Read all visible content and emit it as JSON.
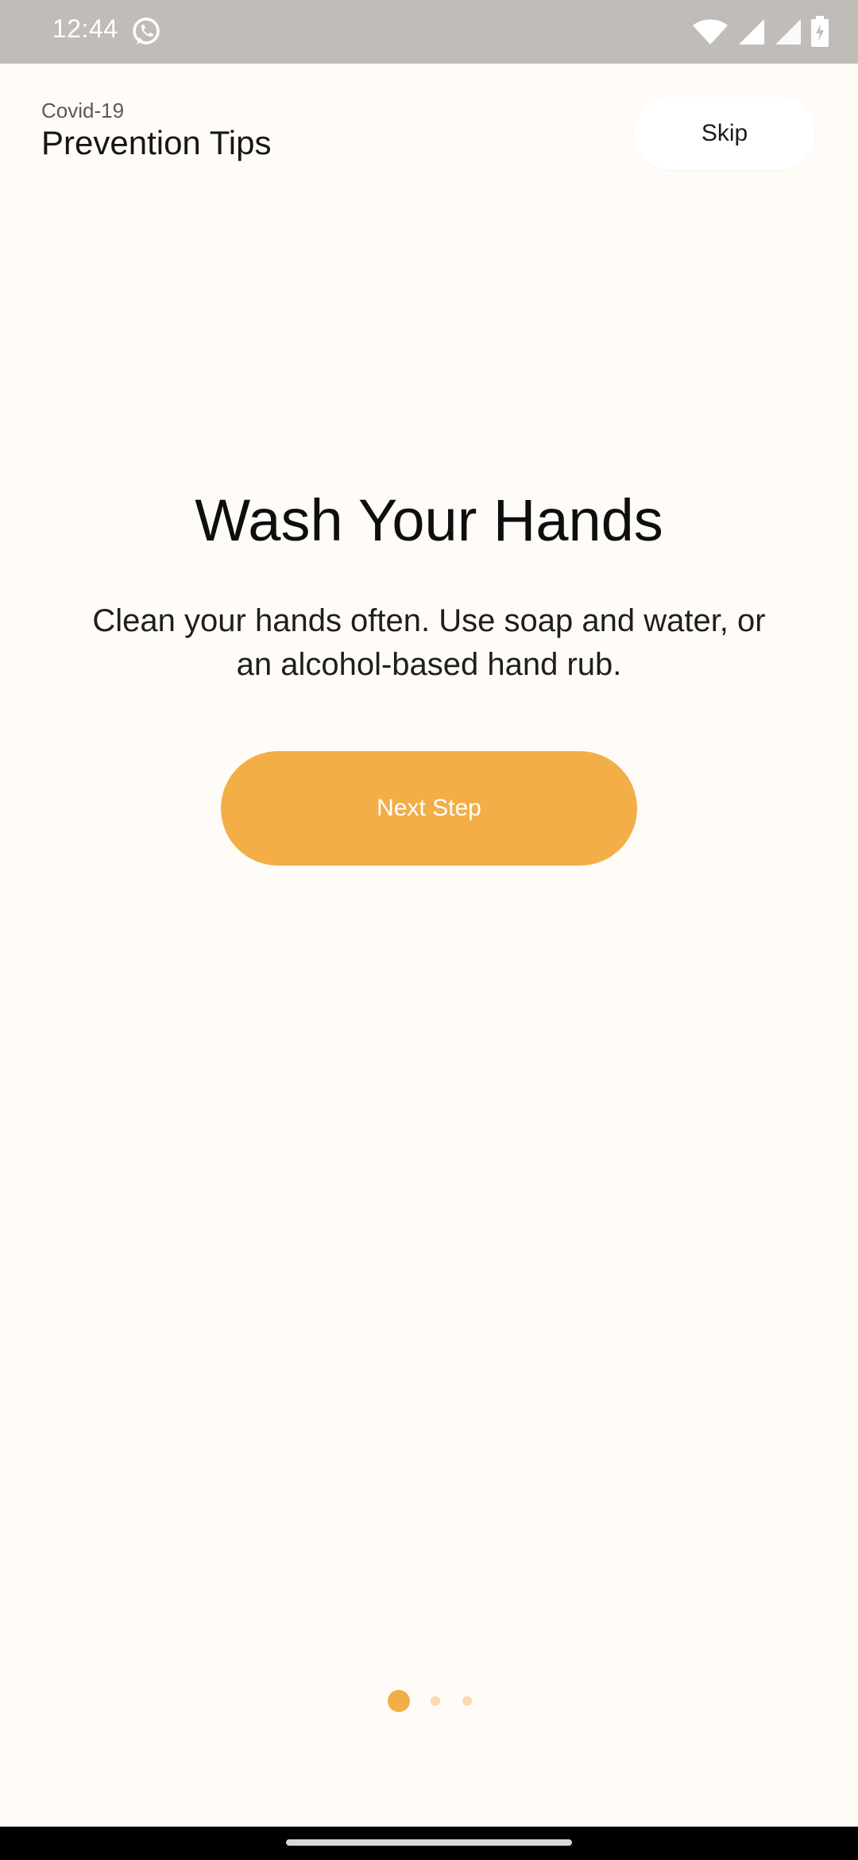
{
  "status_bar": {
    "time": "12:44",
    "icons": [
      "whatsapp-icon",
      "wifi-icon",
      "signal-icon",
      "signal-icon",
      "battery-charging-icon"
    ]
  },
  "header": {
    "subtitle": "Covid-19",
    "title": "Prevention Tips",
    "skip_label": "Skip"
  },
  "slide": {
    "title": "Wash Your Hands",
    "description": "Clean your hands often. Use soap and water, or an alcohol-based hand rub.",
    "next_label": "Next Step"
  },
  "pager": {
    "total_pages": 3,
    "current_page": 1
  },
  "colors": {
    "accent": "#F3AE47",
    "accent_light": "#F8DCAE",
    "background": "#FFFCF8",
    "status_bar": "#C0BDB8"
  }
}
